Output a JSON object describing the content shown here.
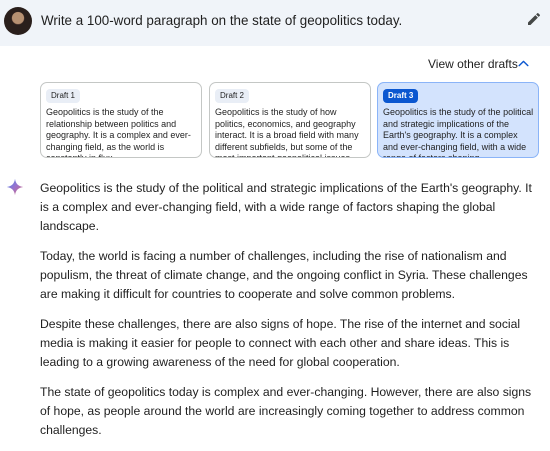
{
  "prompt": {
    "text": "Write a 100-word paragraph on the state of geopolitics today."
  },
  "drafts": {
    "toggle_label": "View other drafts",
    "items": [
      {
        "label": "Draft 1",
        "text": "Geopolitics is the study of the relationship between politics and geography. It is a complex and ever-changing field, as the world is constantly in flux.",
        "selected": false
      },
      {
        "label": "Draft 2",
        "text": "Geopolitics is the study of how politics, economics, and geography interact. It is a broad field with many different subfields, but some of the most important geopolitical issues",
        "selected": false
      },
      {
        "label": "Draft 3",
        "text": "Geopolitics is the study of the political and strategic implications of the Earth's geography. It is a complex and ever-changing field, with a wide range of factors shaping",
        "selected": true
      }
    ]
  },
  "response": {
    "paragraphs": [
      "Geopolitics is the study of the political and strategic implications of the Earth's geography. It is a complex and ever-changing field, with a wide range of factors shaping the global landscape.",
      "Today, the world is facing a number of challenges, including the rise of nationalism and populism, the threat of climate change, and the ongoing conflict in Syria. These challenges are making it difficult for countries to cooperate and solve common problems.",
      "Despite these challenges, there are also signs of hope. The rise of the internet and social media is making it easier for people to connect with each other and share ideas. This is leading to a growing awareness of the need for global cooperation.",
      "The state of geopolitics today is complex and ever-changing. However, there are also signs of hope, as people around the world are increasingly coming together to address common challenges."
    ]
  },
  "colors": {
    "accent": "#0b57d0",
    "selected_card": "#d3e3fd",
    "prompt_bg": "#f0f4f9"
  }
}
